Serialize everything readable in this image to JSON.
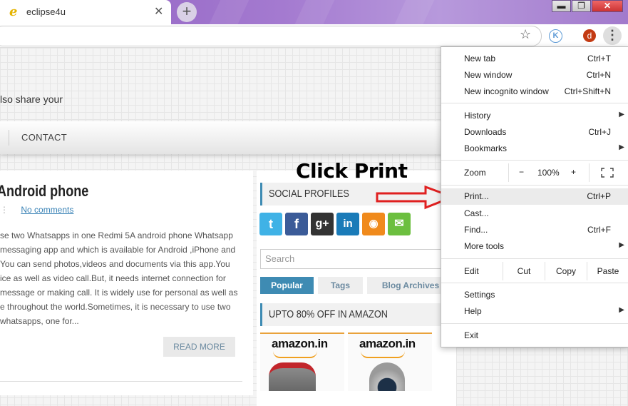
{
  "browser": {
    "tab_title": "eclipse4u",
    "tab_favicon": "e",
    "tab_close": "✕",
    "new_tab": "+",
    "window_buttons": [
      "▬",
      "❐",
      "✕"
    ],
    "bookmark_icon": "☆",
    "extension_letter": "K",
    "avatar_letter": "d",
    "menu_dots": "⋮"
  },
  "page": {
    "intro_text": "lso share your",
    "nav_contact": "CONTACT",
    "post": {
      "title": "Android phone",
      "meta_sep": "⋮",
      "comments_link": "No comments",
      "excerpt": "se two Whatsapps in one Redmi 5A android phone Whatsapp messaging app and which is available for Android ,iPhone and You can send photos,videos and documents via this app.You ice as well as video call.But, it needs internet connection for message or making call. It is widely use for personal as well as e throughout the world.Sometimes, it is necessary to use two whatsapps, one for...",
      "read_more": "READ MORE"
    },
    "sidebar": {
      "social_heading": "SOCIAL PROFILES",
      "social_icons": [
        "twitter-icon",
        "facebook-icon",
        "googleplus-icon",
        "linkedin-icon",
        "rss-icon",
        "email-icon"
      ],
      "search_placeholder": "Search",
      "tabs": [
        "Popular",
        "Tags",
        "Blog Archives"
      ],
      "amazon_heading": "UPTO 80% OFF IN AMAZON",
      "products": [
        "amazon.in",
        "amazon.in"
      ]
    }
  },
  "annotation": {
    "text": "Click Print",
    "arrow_color": "#e02020"
  },
  "menu": {
    "new_tab": {
      "label": "New tab",
      "shortcut": "Ctrl+T"
    },
    "new_window": {
      "label": "New window",
      "shortcut": "Ctrl+N"
    },
    "incognito": {
      "label": "New incognito window",
      "shortcut": "Ctrl+Shift+N"
    },
    "history": {
      "label": "History"
    },
    "downloads": {
      "label": "Downloads",
      "shortcut": "Ctrl+J"
    },
    "bookmarks": {
      "label": "Bookmarks"
    },
    "zoom": {
      "label": "Zoom",
      "minus": "−",
      "value": "100%",
      "plus": "+"
    },
    "print": {
      "label": "Print...",
      "shortcut": "Ctrl+P"
    },
    "cast": {
      "label": "Cast..."
    },
    "find": {
      "label": "Find...",
      "shortcut": "Ctrl+F"
    },
    "more_tools": {
      "label": "More tools"
    },
    "edit": {
      "label": "Edit",
      "cut": "Cut",
      "copy": "Copy",
      "paste": "Paste"
    },
    "settings": {
      "label": "Settings"
    },
    "help": {
      "label": "Help"
    },
    "exit": {
      "label": "Exit"
    },
    "submenu_arrow": "▶"
  },
  "colors": {
    "tabbar": "#9a6fc8",
    "accent_blue": "#3e8bb3",
    "menu_highlight": "#ebebeb"
  }
}
